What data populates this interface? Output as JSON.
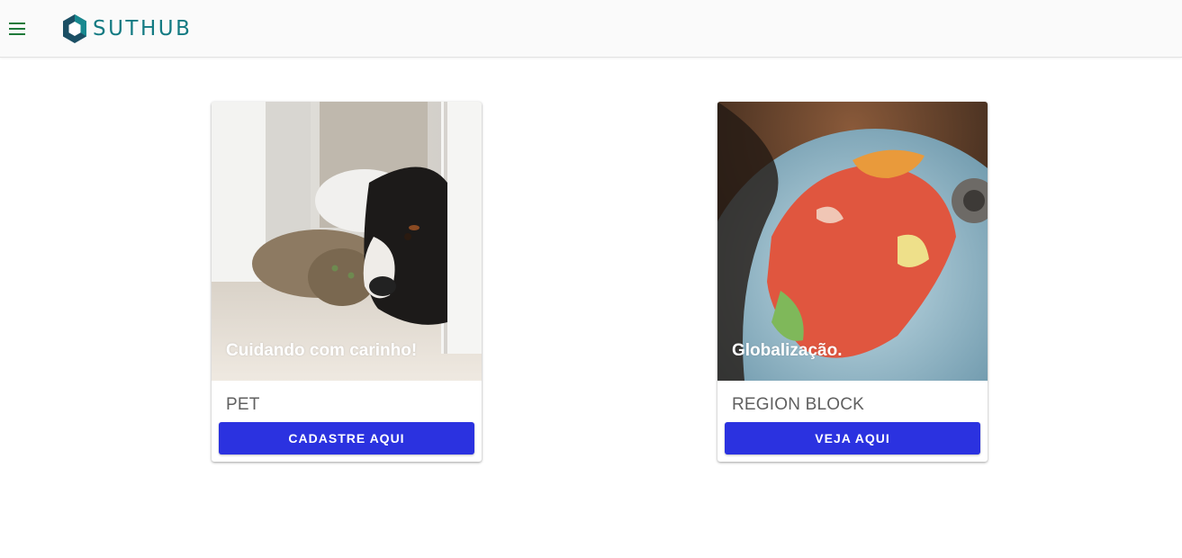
{
  "header": {
    "menu_icon": "hamburger-menu-icon",
    "brand": "SUTHUB",
    "brand_color": "#137a82",
    "logo_icon": "hexagon-logo-icon"
  },
  "cards": [
    {
      "image": "cat-and-dog-photo",
      "caption": "Cuidando com carinho!",
      "title": "PET",
      "button_label": "CADASTRE AQUI"
    },
    {
      "image": "world-globe-photo",
      "caption": "Globalização.",
      "title": "REGION BLOCK",
      "button_label": "VEJA AQUI"
    }
  ],
  "colors": {
    "button": "#2b32e0",
    "topbar": "#fafafa",
    "menu_icon": "#1f7a3a"
  }
}
